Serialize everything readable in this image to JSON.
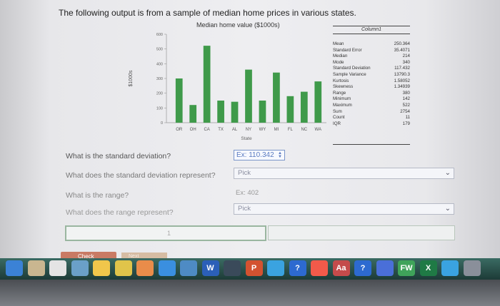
{
  "question": {
    "intro": "The following output is from a sample of median home prices in various states."
  },
  "chart_data": {
    "type": "bar",
    "title": "Median home value ($1000s)",
    "xlabel": "State",
    "ylabel": "$1000s",
    "categories": [
      "OR",
      "OH",
      "CA",
      "TX",
      "AL",
      "NY",
      "WY",
      "MI",
      "FL",
      "NC",
      "WA"
    ],
    "values": [
      300,
      120,
      522,
      150,
      142,
      360,
      150,
      340,
      180,
      210,
      280
    ],
    "ylim": [
      0,
      600
    ],
    "yticks": [
      0,
      100,
      200,
      300,
      400,
      500,
      600
    ],
    "color": "#3f9a4a",
    "grid": false,
    "legend": "none"
  },
  "stats": {
    "header": "Column1",
    "rows": [
      {
        "label": "Mean",
        "value": "250.364"
      },
      {
        "label": "Standard Error",
        "value": "35.4071"
      },
      {
        "label": "Median",
        "value": "214"
      },
      {
        "label": "Mode",
        "value": "340"
      },
      {
        "label": "Standard Deviation",
        "value": "117.432"
      },
      {
        "label": "Sample Variance",
        "value": "13790.3"
      },
      {
        "label": "Kurtosis",
        "value": "1.58052"
      },
      {
        "label": "Skewness",
        "value": "1.34939"
      },
      {
        "label": "Range",
        "value": "380"
      },
      {
        "label": "Minimum",
        "value": "142"
      },
      {
        "label": "Maximum",
        "value": "522"
      },
      {
        "label": "Sum",
        "value": "2754"
      },
      {
        "label": "Count",
        "value": "11"
      },
      {
        "label": "IQR",
        "value": "179"
      }
    ]
  },
  "form": {
    "q_std": "What is the standard deviation?",
    "std_value": "Ex: 110.342",
    "q_std_meaning": "What does the standard deviation represent?",
    "pick1": "Pick",
    "q_range": "What is the range?",
    "range_hint": "Ex: 402",
    "q_range_meaning": "What does the range represent?",
    "pick2": "Pick",
    "cursor": "1",
    "check": "Check",
    "next": "Next"
  },
  "taskbar": {
    "icons": [
      {
        "name": "finder-icon",
        "color": "#3b82d6",
        "label": ""
      },
      {
        "name": "launchpad-icon",
        "color": "#c9b690",
        "label": ""
      },
      {
        "name": "calendar-icon",
        "color": "#e4e4e4",
        "label": ""
      },
      {
        "name": "preview-icon",
        "color": "#6aa0c8",
        "label": ""
      },
      {
        "name": "notes-icon",
        "color": "#f0c64b",
        "label": ""
      },
      {
        "name": "chrome-icon",
        "color": "#e0c44a",
        "label": ""
      },
      {
        "name": "photos-icon",
        "color": "#e98c4a",
        "label": ""
      },
      {
        "name": "app-store-icon",
        "color": "#3a8fe0",
        "label": ""
      },
      {
        "name": "keynote-icon",
        "color": "#4e8bc4",
        "label": ""
      },
      {
        "name": "word-icon",
        "color": "#2b5fb8",
        "label": "W"
      },
      {
        "name": "steam-icon",
        "color": "#3a4a5a",
        "label": ""
      },
      {
        "name": "powerpoint-icon",
        "color": "#d35230",
        "label": "P"
      },
      {
        "name": "safari-icon",
        "color": "#3aa3e0",
        "label": ""
      },
      {
        "name": "help-icon",
        "color": "#2d6ad0",
        "label": "?"
      },
      {
        "name": "music-icon",
        "color": "#f25a4a",
        "label": ""
      },
      {
        "name": "dictionary-icon",
        "color": "#c44b4b",
        "label": "Aa"
      },
      {
        "name": "help-icon-2",
        "color": "#2d6ad0",
        "label": "?"
      },
      {
        "name": "zoom-icon",
        "color": "#4a6fd8",
        "label": ""
      },
      {
        "name": "facetime-icon",
        "color": "#3fa35a",
        "label": "FW"
      },
      {
        "name": "excel-icon",
        "color": "#1f7a45",
        "label": "X"
      },
      {
        "name": "messages-icon",
        "color": "#3aa3e0",
        "label": ""
      },
      {
        "name": "system-prefs-icon",
        "color": "#8a8f9a",
        "label": ""
      }
    ]
  }
}
